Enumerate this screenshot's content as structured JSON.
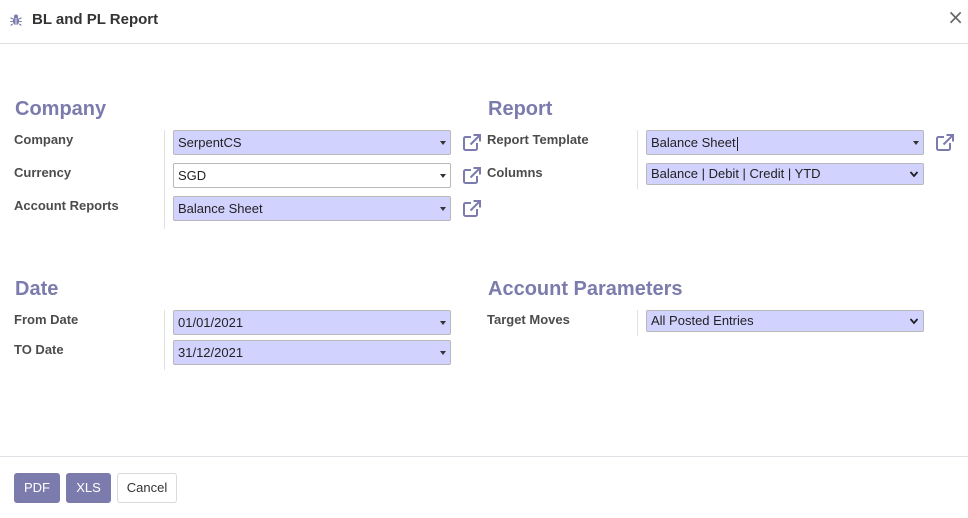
{
  "dialog": {
    "title": "BL and PL Report",
    "close_symbol": "×",
    "icon": "bug-icon"
  },
  "company_section": {
    "title": "Company",
    "company_label": "Company",
    "company_value": "SerpentCS",
    "currency_label": "Currency",
    "currency_value": "SGD",
    "account_reports_label": "Account Reports",
    "account_reports_value": "Balance Sheet"
  },
  "report_section": {
    "title": "Report",
    "template_label": "Report Template",
    "template_value": "Balance Sheet",
    "columns_label": "Columns",
    "columns_value": "Balance | Debit | Credit | YTD"
  },
  "date_section": {
    "title": "Date",
    "from_label": "From Date",
    "from_value": "01/01/2021",
    "to_label": "TO Date",
    "to_value": "31/12/2021"
  },
  "account_params_section": {
    "title": "Account Parameters",
    "target_moves_label": "Target Moves",
    "target_moves_value": "All Posted Entries"
  },
  "footer": {
    "pdf_label": "PDF",
    "xls_label": "XLS",
    "cancel_label": "Cancel"
  },
  "colors": {
    "accent": "#7c7bad",
    "field_bg": "#d2d2ff"
  }
}
